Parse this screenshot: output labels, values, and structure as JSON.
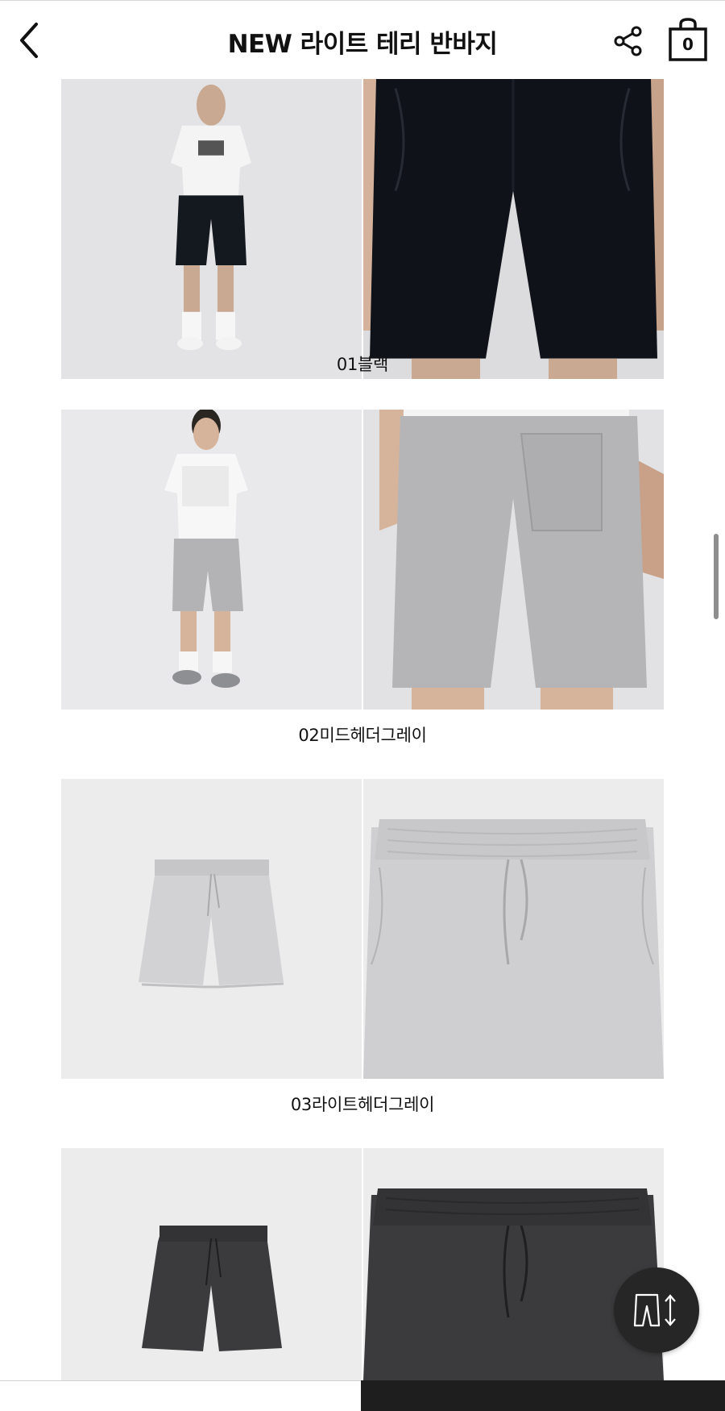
{
  "header": {
    "title": "NEW 라이트 테리 반바지",
    "back_icon": "chevron-left-icon",
    "share_icon": "share-icon",
    "cart_icon": "shopping-bag-icon",
    "cart_count": "0"
  },
  "products": [
    {
      "caption": "01블랙",
      "color": "#14181f"
    },
    {
      "caption": "02미드헤더그레이",
      "color": "#b3b3b5"
    },
    {
      "caption": "03라이트헤더그레이",
      "color": "#d0d0d2"
    },
    {
      "caption": "",
      "color": "#3b3b3d"
    }
  ],
  "floating": {
    "size_icon": "size-guide-icon"
  }
}
